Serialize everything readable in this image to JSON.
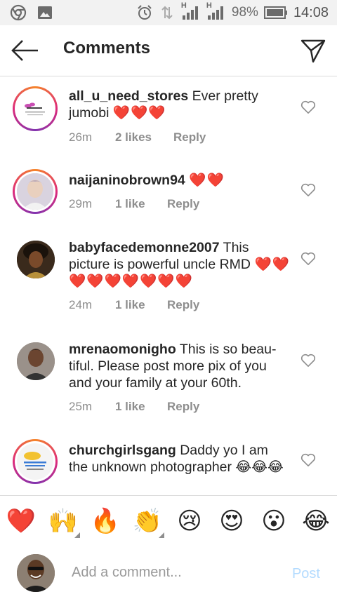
{
  "status_bar": {
    "battery": "98%",
    "time": "14:08",
    "net_label_1": "H",
    "net_label_2": "H"
  },
  "header": {
    "title": "Comments"
  },
  "comments": [
    {
      "username": "all_u_need_stores",
      "text": " Ever pretty jumobi ",
      "hearts": "❤️❤️❤️",
      "time": "26m",
      "likes": "2 likes",
      "reply": "Reply",
      "avatar_text": "ALL U NEED"
    },
    {
      "username": "naijaninobrown94",
      "text": " ",
      "hearts": "❤️❤️",
      "time": "29m",
      "likes": "1 like",
      "reply": "Reply"
    },
    {
      "username": "babyfacedemonne2007",
      "text": " This picture is powerful uncle RMD ",
      "hearts": "❤️❤️❤️❤️❤️❤️❤️❤️❤️",
      "time": "24m",
      "likes": "1 like",
      "reply": "Reply"
    },
    {
      "username": "mrenaomonigho",
      "text": " This is so beau-tiful. Please post more pix of you and your family at your 60th.",
      "hearts": "",
      "time": "25m",
      "likes": "1 like",
      "reply": "Reply"
    },
    {
      "username": "churchgirlsgang",
      "text": " Daddy yo I am the unknown photographer 😂😂😂",
      "hearts": "",
      "time": "",
      "likes": "",
      "reply": ""
    }
  ],
  "emojis": [
    "❤️",
    "🙌",
    "🔥",
    "👏",
    "😢",
    "😍",
    "😮",
    "😂"
  ],
  "input": {
    "placeholder": "Add a comment...",
    "post_label": "Post"
  },
  "colors": {
    "heart": "#e0141e",
    "post_disabled": "#b3dbff",
    "meta": "#8e8e8e"
  }
}
